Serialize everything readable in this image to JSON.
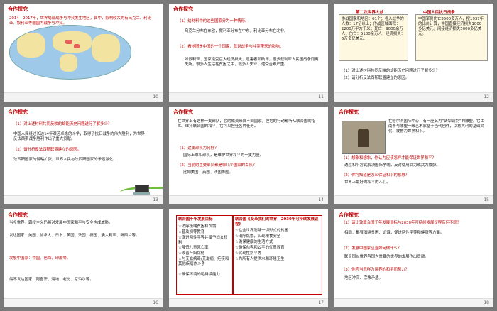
{
  "slides": [
    {
      "num": "10",
      "title": "合作探究",
      "text1": "2014—2017年，世界局部战争与冲突发生地区，其中，影响较大的有乌克兰、利比亚、叙利亚等国国内战争与冲突。"
    },
    {
      "num": "11",
      "title": "合作探究",
      "q1": "（1）给材料中的这些国家分为一种情形。",
      "a1": "乌克兰分布在东欧，叙利亚分布在中东，利比亚分布在北非。",
      "q2": "（2）看地图是中国的一个国家，就说战争与冲突带来的影响。",
      "a2": "如叙利亚、国家遭受巨大经济损失，遗害者和破坏，很多叙利亚人民因战争而离失所，很多人生活在贫困之中，很多人失业、遭受苦难严重。"
    },
    {
      "num": "12",
      "left_head": "第二次世界大战",
      "right_head": "中国人民抗日战争",
      "left_text": "参战国家和地区：61个；卷入战争的人数：17亿以上；作战区域面积：2200万平方千米；死亡：9000余万人；伤亡：5100余万人；经济损失：5万多亿美元。",
      "right_text": "中国军民伤亡3500多万人，按1937年的比价计算，中国直接经济损失1000多亿美元，间接经济损失5000多亿美元。",
      "q1": "（1）对上述材料共同反映的却能历史问题进行了解多少？",
      "q2": "（2）请分析反法西斯联盟建立的原因。"
    },
    {
      "num": "13",
      "title": "合作探究",
      "q1": "（1）对上述材料共同反映的却能历史问题进行了解多少？",
      "a1": "中国人民经过长达14年艰苦卓绝的斗争，取得了抗日战争的伟大胜利，为世界反法西斯战争胜利作出了重大贡献。",
      "q2": "（2）请分析反法西斯联盟建立的原因。",
      "a2": "法西斯国家的侵略扩张，世界人民与法西斯国家的矛盾激化。"
    },
    {
      "num": "14",
      "title": "合作探究",
      "p1": "在世界上有这样一支部队，它的成员来自不同国家，但它的行动都听从联合国的指挥。维持联合国的和平，它可以担任各种任务。",
      "q1": "（1）这支部队为何称？",
      "a1": "国际上维和部队，是维护世界和平的一支力量。",
      "q2": "（2）当前的主要部队都是哪几个国家的军队？",
      "a2": "比如美国、英国、法国等国。"
    },
    {
      "num": "15",
      "title": "合作探究",
      "p1": "在哈尔滨国际中心，有一座名为“铸犁铸剑”的雕塑。它由南条与雕塑一级艺术家基于当代创作，以意大利的基础文化，被誉为世界和平。",
      "q1": "（1）想象和想象，你认为应该怎样才能保证世界和平？",
      "a1": "通过和平方式解决国际争端，反对使用武力或武力威胁。",
      "q2": "（2）你可知道是怎么保证和平的意思？",
      "a2": "世界上最好的和平的人们。"
    },
    {
      "num": "16",
      "title": "合作探究",
      "p1": "当今世界，霸权主义仍将对发展中国家和平与安全构成威胁。",
      "p2": "发达国家：美国、加拿大、日本、英国、法国、德国、澳大利亚、新西兰等。",
      "p3": "发展中国家：中国、巴西、印度等。",
      "p4": "最不发达国家：阿富汗、海地、老挝、尼泊尔等。"
    },
    {
      "num": "17",
      "left_title": "联合国千年发展目标",
      "left_items": [
        "☆消除极端贫困和饥饿",
        "☆普及初等教育",
        "☆促进两性平等并赋予妇女权利",
        "☆降低儿童死亡率",
        "☆改善产妇保健",
        "☆与艾滋病毒/艾滋病、疟疾和其他疾病作斗争",
        "☆确保环境的可持续能力"
      ],
      "right_title": "联合国《变革我们的世界：2030年可持续发展议程》",
      "right_items": [
        "☆在全世界消除一切形式的贫困",
        "☆消除饥饿，实现粮食安全",
        "☆确保健康的生活方式",
        "☆确保包容和公平的优质教育",
        "☆实现性别平等",
        "☆为所有人提供水和环境卫生"
      ]
    },
    {
      "num": "18",
      "title": "合作探究",
      "q1": "（1）请比较联合国千年发展目标与2030年可持续发展议程有何不同？",
      "a1": "相同：都有消除贫困、饥饿，促进两性平等和健康等方面。",
      "q2": "（2）发展中国家应当如何做什么？",
      "a2": "联合国以世界各国为重要的世界的发展作出贡献。",
      "q3": "（3）你应当怎样为世界的和平而努力？",
      "a3": "地区冲突、宗教矛盾。"
    }
  ],
  "colors": {
    "accent": "#c00000",
    "background": "#7a7a7a",
    "green": "#6fbf3c"
  }
}
